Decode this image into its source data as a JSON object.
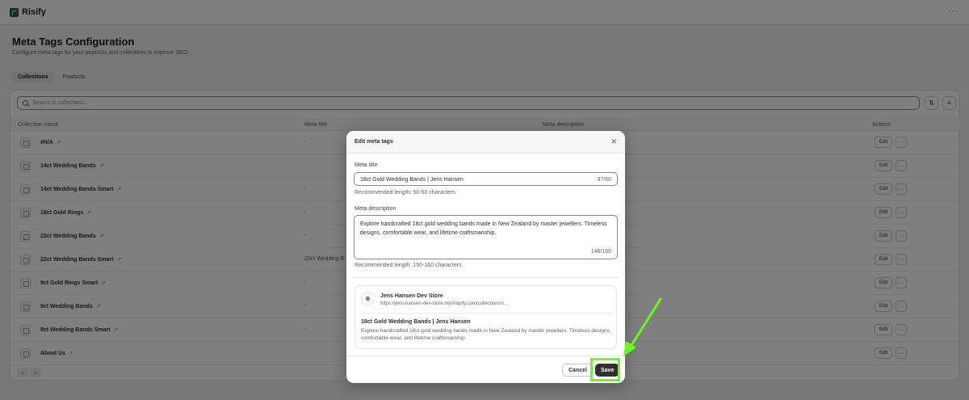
{
  "app": {
    "name": "Risify",
    "more": "···"
  },
  "page": {
    "title": "Meta Tags Configuration",
    "subtitle": "Configure meta tags for your products and collections to improve SEO.",
    "tabs": [
      {
        "label": "Collections",
        "active": true
      },
      {
        "label": "Products",
        "active": false
      }
    ]
  },
  "search": {
    "placeholder": "Search in collections..."
  },
  "toolbar": {
    "sort_glyph": "⇅",
    "filter_glyph": "≡"
  },
  "table": {
    "headers": {
      "name": "Collection name",
      "meta_title": "Meta title",
      "meta_description": "Meta description",
      "actions": "Actions"
    },
    "rows": [
      {
        "name": "#N/A",
        "meta_title": "-"
      },
      {
        "name": "14ct Wedding Bands",
        "meta_title": ""
      },
      {
        "name": "14ct Wedding Bands Smart",
        "meta_title": "-"
      },
      {
        "name": "18ct Gold Rings",
        "meta_title": "-"
      },
      {
        "name": "22ct Wedding Bands",
        "meta_title": "-"
      },
      {
        "name": "22ct Wedding Bands Smart",
        "meta_title": "22ct Wedding B"
      },
      {
        "name": "9ct Gold Rings Smart",
        "meta_title": "-"
      },
      {
        "name": "9ct Wedding Bands",
        "meta_title": "-"
      },
      {
        "name": "9ct Wedding Bands Smart",
        "meta_title": "-"
      },
      {
        "name": "About Us",
        "meta_title": "-"
      }
    ],
    "edit_label": "Edit",
    "more_label": "···",
    "ext_glyph": "↗"
  },
  "pager": {
    "prev": "‹",
    "next": "›"
  },
  "modal": {
    "title": "Edit meta tags",
    "close_glyph": "✕",
    "meta_title_label": "Meta title",
    "meta_title_value": "18ct Gold Wedding Bands | Jens Hansen",
    "meta_title_count": "37/60",
    "meta_title_help": "Recommended length: 50-60 characters",
    "meta_desc_label": "Meta description",
    "meta_desc_value": "Explore handcrafted 18ct gold wedding bands made in New Zealand by master jewellers. Timeless designs, comfortable wear, and lifetime craftsmanship.",
    "meta_desc_count": "148/160",
    "meta_desc_help": "Recommended length: 150-160 characters",
    "preview": {
      "store": "Jens Hansen Dev Store",
      "url": "https://jens-hansen-dev-store.myshopify.com/collections/s...",
      "title": "18ct Gold Wedding Bands | Jens Hansen",
      "description": "Explore handcrafted 18ct gold wedding bands made in New Zealand by master jewellers. Timeless designs, comfortable wear, and lifetime craftsmanship."
    },
    "cancel_label": "Cancel",
    "save_label": "Save"
  },
  "colors": {
    "accent": "#66ff1f",
    "primary_button": "#303030",
    "overlay": "rgba(0,0,0,0.5)"
  }
}
